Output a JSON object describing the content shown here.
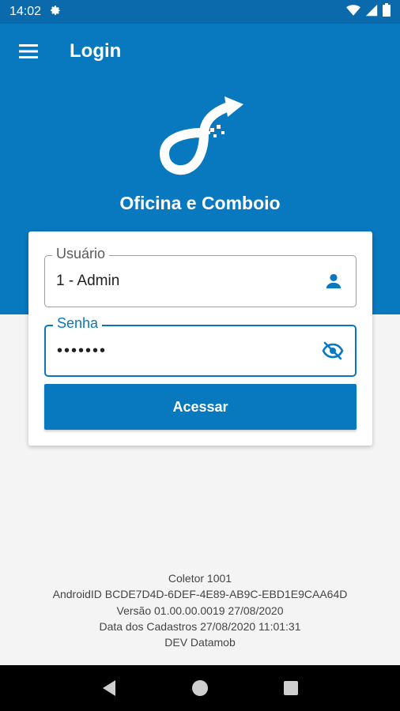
{
  "status_bar": {
    "time": "14:02",
    "icons": [
      "settings-gear-icon",
      "wifi-icon",
      "signal-icon",
      "battery-icon"
    ]
  },
  "app_bar": {
    "title": "Login",
    "menu_icon": "hamburger-menu-icon"
  },
  "header": {
    "logo_icon": "oficina-comboio-logo",
    "app_name": "Oficina e Comboio"
  },
  "form": {
    "user_label": "Usuário",
    "user_value": "1 - Admin",
    "user_icon": "person-icon",
    "password_label": "Senha",
    "password_value": "•••••••",
    "password_icon": "eye-off-icon",
    "submit_label": "Acessar"
  },
  "info": {
    "lines": [
      "Coletor 1001",
      "AndroidID BCDE7D4D-6DEF-4E89-AB9C-EBD1E9CAA64D",
      "Versão 01.00.00.0019 27/08/2020",
      "Data dos Cadastros 27/08/2020 11:01:31",
      "DEV Datamob"
    ]
  },
  "nav_bar": {
    "icons": [
      "back-icon",
      "home-icon",
      "recents-icon"
    ]
  },
  "colors": {
    "primary": "#0878bf",
    "status_bar": "#0a6aab",
    "background": "#f4f4f4"
  }
}
